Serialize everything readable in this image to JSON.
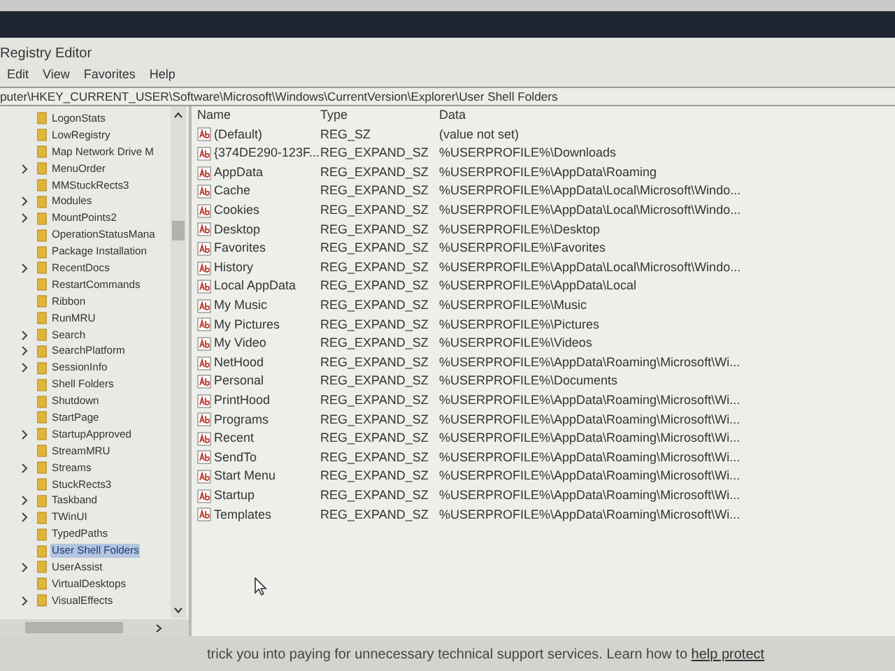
{
  "window": {
    "title": "Registry Editor"
  },
  "menu": [
    {
      "label": "Edit"
    },
    {
      "label": "View"
    },
    {
      "label": "Favorites"
    },
    {
      "label": "Help"
    }
  ],
  "address": "puter\\HKEY_CURRENT_USER\\Software\\Microsoft\\Windows\\CurrentVersion\\Explorer\\User Shell Folders",
  "tree": {
    "items": [
      {
        "label": "LogonStats",
        "has_children": false,
        "selected": false
      },
      {
        "label": "LowRegistry",
        "has_children": false,
        "selected": false
      },
      {
        "label": "Map Network Drive M",
        "has_children": false,
        "selected": false
      },
      {
        "label": "MenuOrder",
        "has_children": true,
        "selected": false
      },
      {
        "label": "MMStuckRects3",
        "has_children": false,
        "selected": false
      },
      {
        "label": "Modules",
        "has_children": true,
        "selected": false
      },
      {
        "label": "MountPoints2",
        "has_children": true,
        "selected": false
      },
      {
        "label": "OperationStatusMana",
        "has_children": false,
        "selected": false
      },
      {
        "label": "Package Installation",
        "has_children": false,
        "selected": false
      },
      {
        "label": "RecentDocs",
        "has_children": true,
        "selected": false
      },
      {
        "label": "RestartCommands",
        "has_children": false,
        "selected": false
      },
      {
        "label": "Ribbon",
        "has_children": false,
        "selected": false
      },
      {
        "label": "RunMRU",
        "has_children": false,
        "selected": false
      },
      {
        "label": "Search",
        "has_children": true,
        "selected": false
      },
      {
        "label": "SearchPlatform",
        "has_children": true,
        "selected": false
      },
      {
        "label": "SessionInfo",
        "has_children": true,
        "selected": false
      },
      {
        "label": "Shell Folders",
        "has_children": false,
        "selected": false
      },
      {
        "label": "Shutdown",
        "has_children": false,
        "selected": false
      },
      {
        "label": "StartPage",
        "has_children": false,
        "selected": false
      },
      {
        "label": "StartupApproved",
        "has_children": true,
        "selected": false
      },
      {
        "label": "StreamMRU",
        "has_children": false,
        "selected": false
      },
      {
        "label": "Streams",
        "has_children": true,
        "selected": false
      },
      {
        "label": "StuckRects3",
        "has_children": false,
        "selected": false
      },
      {
        "label": "Taskband",
        "has_children": true,
        "selected": false
      },
      {
        "label": "TWinUI",
        "has_children": true,
        "selected": false
      },
      {
        "label": "TypedPaths",
        "has_children": false,
        "selected": false
      },
      {
        "label": "User Shell Folders",
        "has_children": false,
        "selected": true
      },
      {
        "label": "UserAssist",
        "has_children": true,
        "selected": false
      },
      {
        "label": "VirtualDesktops",
        "has_children": false,
        "selected": false
      },
      {
        "label": "VisualEffects",
        "has_children": true,
        "selected": false
      }
    ]
  },
  "table": {
    "columns": [
      "Name",
      "Type",
      "Data"
    ],
    "rows": [
      [
        "(Default)",
        "REG_SZ",
        "(value not set)"
      ],
      [
        "{374DE290-123F...",
        "REG_EXPAND_SZ",
        "%USERPROFILE%\\Downloads"
      ],
      [
        "AppData",
        "REG_EXPAND_SZ",
        "%USERPROFILE%\\AppData\\Roaming"
      ],
      [
        "Cache",
        "REG_EXPAND_SZ",
        "%USERPROFILE%\\AppData\\Local\\Microsoft\\Windo..."
      ],
      [
        "Cookies",
        "REG_EXPAND_SZ",
        "%USERPROFILE%\\AppData\\Local\\Microsoft\\Windo..."
      ],
      [
        "Desktop",
        "REG_EXPAND_SZ",
        "%USERPROFILE%\\Desktop"
      ],
      [
        "Favorites",
        "REG_EXPAND_SZ",
        "%USERPROFILE%\\Favorites"
      ],
      [
        "History",
        "REG_EXPAND_SZ",
        "%USERPROFILE%\\AppData\\Local\\Microsoft\\Windo..."
      ],
      [
        "Local AppData",
        "REG_EXPAND_SZ",
        "%USERPROFILE%\\AppData\\Local"
      ],
      [
        "My Music",
        "REG_EXPAND_SZ",
        "%USERPROFILE%\\Music"
      ],
      [
        "My Pictures",
        "REG_EXPAND_SZ",
        "%USERPROFILE%\\Pictures"
      ],
      [
        "My Video",
        "REG_EXPAND_SZ",
        "%USERPROFILE%\\Videos"
      ],
      [
        "NetHood",
        "REG_EXPAND_SZ",
        "%USERPROFILE%\\AppData\\Roaming\\Microsoft\\Wi..."
      ],
      [
        "Personal",
        "REG_EXPAND_SZ",
        "%USERPROFILE%\\Documents"
      ],
      [
        "PrintHood",
        "REG_EXPAND_SZ",
        "%USERPROFILE%\\AppData\\Roaming\\Microsoft\\Wi..."
      ],
      [
        "Programs",
        "REG_EXPAND_SZ",
        "%USERPROFILE%\\AppData\\Roaming\\Microsoft\\Wi..."
      ],
      [
        "Recent",
        "REG_EXPAND_SZ",
        "%USERPROFILE%\\AppData\\Roaming\\Microsoft\\Wi..."
      ],
      [
        "SendTo",
        "REG_EXPAND_SZ",
        "%USERPROFILE%\\AppData\\Roaming\\Microsoft\\Wi..."
      ],
      [
        "Start Menu",
        "REG_EXPAND_SZ",
        "%USERPROFILE%\\AppData\\Roaming\\Microsoft\\Wi..."
      ],
      [
        "Startup",
        "REG_EXPAND_SZ",
        "%USERPROFILE%\\AppData\\Roaming\\Microsoft\\Wi..."
      ],
      [
        "Templates",
        "REG_EXPAND_SZ",
        "%USERPROFILE%\\AppData\\Roaming\\Microsoft\\Wi..."
      ]
    ]
  },
  "footer": {
    "text": "trick you into paying for unnecessary technical support services. Learn how to",
    "link": "help protect"
  }
}
